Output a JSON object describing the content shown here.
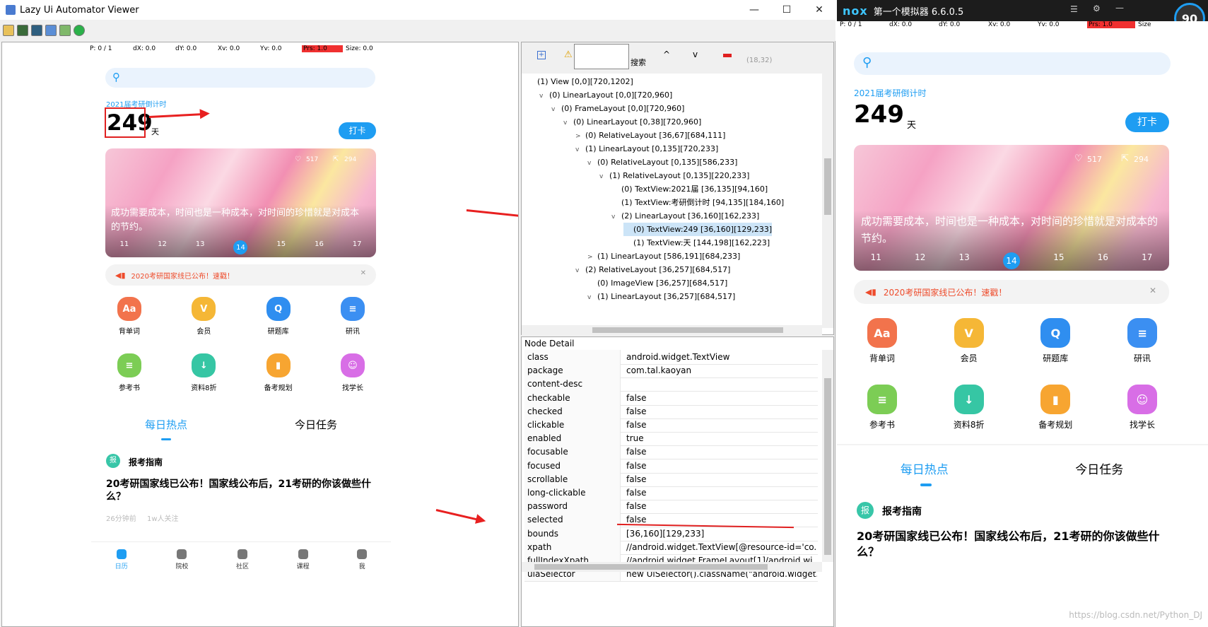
{
  "viewer": {
    "title": "Lazy Ui Automator Viewer",
    "win_minimize": "—",
    "win_maximize": "☐",
    "win_close": "✕"
  },
  "pointer": {
    "p": "P: 0 / 1",
    "dx": "dX: 0.0",
    "dy": "dY: 0.0",
    "xv": "Xv: 0.0",
    "yv": "Yv: 0.0",
    "prs": "Prs: 1.0",
    "size": "Size: 0.0"
  },
  "app": {
    "countdown_label": "2021届考研倒计时",
    "countdown_days": "249",
    "days_unit": "天",
    "checkin_button": "打卡",
    "likes": "517",
    "shares": "294",
    "quote": "成功需要成本，时间也是一种成本，对时间的珍惜就是对成本的节约。",
    "days": [
      "11",
      "12",
      "13",
      "14",
      "15",
      "16",
      "17"
    ],
    "active_day": "14",
    "notice": "2020考研国家线已公布！速戳！",
    "icons": [
      {
        "label": "背单词",
        "color": "#f2734c",
        "glyph": "Aa"
      },
      {
        "label": "会员",
        "color": "#f5b736",
        "glyph": "V"
      },
      {
        "label": "研题库",
        "color": "#2f8ef0",
        "glyph": "Q"
      },
      {
        "label": "研讯",
        "color": "#3b8ff2",
        "glyph": "≡"
      },
      {
        "label": "参考书",
        "color": "#7ccd55",
        "glyph": "≡"
      },
      {
        "label": "资料8折",
        "color": "#36c6a4",
        "glyph": "↓"
      },
      {
        "label": "备考规划",
        "color": "#f7a531",
        "glyph": "▮"
      },
      {
        "label": "找学长",
        "color": "#d86ee6",
        "glyph": "☺"
      }
    ],
    "tab_hot": "每日热点",
    "tab_tasks": "今日任务",
    "section_badge": "报",
    "section_title": "报考指南",
    "headline": "20考研国家线已公布！国家线公布后，21考研的你该做些什么？",
    "time_ago": "26分钟前",
    "followers": "1w人关注",
    "nav": [
      "日历",
      "院校",
      "社区",
      "课程",
      "我"
    ]
  },
  "hierarchy": {
    "search_label": "搜索",
    "coords": "(18,32)",
    "nodes": [
      {
        "text": "(1) View [0,0][720,1202]",
        "depth": 0,
        "tw": ""
      },
      {
        "text": "(0) LinearLayout [0,0][720,960]",
        "depth": 1,
        "tw": "v"
      },
      {
        "text": "(0) FrameLayout [0,0][720,960]",
        "depth": 2,
        "tw": "v"
      },
      {
        "text": "(0) LinearLayout [0,38][720,960]",
        "depth": 3,
        "tw": "v"
      },
      {
        "text": "(0) RelativeLayout [36,67][684,111]",
        "depth": 4,
        "tw": ">"
      },
      {
        "text": "(1) LinearLayout [0,135][720,233]",
        "depth": 4,
        "tw": "v"
      },
      {
        "text": "(0) RelativeLayout [0,135][586,233]",
        "depth": 5,
        "tw": "v"
      },
      {
        "text": "(1) RelativeLayout [0,135][220,233]",
        "depth": 6,
        "tw": "v"
      },
      {
        "text": "(0) TextView:2021届 [36,135][94,160]",
        "depth": 7,
        "tw": ""
      },
      {
        "text": "(1) TextView:考研倒计时 [94,135][184,160]",
        "depth": 7,
        "tw": ""
      },
      {
        "text": "(2) LinearLayout [36,160][162,233]",
        "depth": 7,
        "tw": "v"
      },
      {
        "text": "(0) TextView:249 [36,160][129,233]",
        "depth": 8,
        "tw": "",
        "selected": true
      },
      {
        "text": "(1) TextView:天 [144,198][162,223]",
        "depth": 8,
        "tw": ""
      },
      {
        "text": "(1) LinearLayout [586,191][684,233]",
        "depth": 5,
        "tw": ">"
      },
      {
        "text": "(2) RelativeLayout [36,257][684,517]",
        "depth": 4,
        "tw": "v"
      },
      {
        "text": "(0) ImageView [36,257][684,517]",
        "depth": 5,
        "tw": ""
      },
      {
        "text": "(1) LinearLayout [36,257][684,517]",
        "depth": 5,
        "tw": "v"
      }
    ]
  },
  "detail": {
    "header": "Node Detail",
    "rows": [
      {
        "k": "class",
        "v": "android.widget.TextView"
      },
      {
        "k": "package",
        "v": "com.tal.kaoyan"
      },
      {
        "k": "content-desc",
        "v": ""
      },
      {
        "k": "checkable",
        "v": "false"
      },
      {
        "k": "checked",
        "v": "false"
      },
      {
        "k": "clickable",
        "v": "false"
      },
      {
        "k": "enabled",
        "v": "true"
      },
      {
        "k": "focusable",
        "v": "false"
      },
      {
        "k": "focused",
        "v": "false"
      },
      {
        "k": "scrollable",
        "v": "false"
      },
      {
        "k": "long-clickable",
        "v": "false"
      },
      {
        "k": "password",
        "v": "false"
      },
      {
        "k": "selected",
        "v": "false"
      },
      {
        "k": "bounds",
        "v": "[36,160][129,233]"
      },
      {
        "k": "xpath",
        "v": "//android.widget.TextView[@resource-id='co..."
      },
      {
        "k": "fullIndexXpath",
        "v": "//android.widget.FrameLayout[1]/android.wi..."
      },
      {
        "k": "uiaSelector",
        "v": "new UiSelector().className(\"android.widget..."
      }
    ]
  },
  "nox": {
    "logo": "nox",
    "title": "第一个模拟器 6.6.0.5",
    "gauge": "90",
    "pointer": {
      "p": "P: 0 / 1",
      "dx": "dX: 0.0",
      "dy": "dY: 0.0",
      "xv": "Xv: 0.0",
      "yv": "Yv: 0.0",
      "prs": "Prs: 1.0",
      "size": "Size"
    },
    "watermark": "https://blog.csdn.net/Python_DJ"
  }
}
